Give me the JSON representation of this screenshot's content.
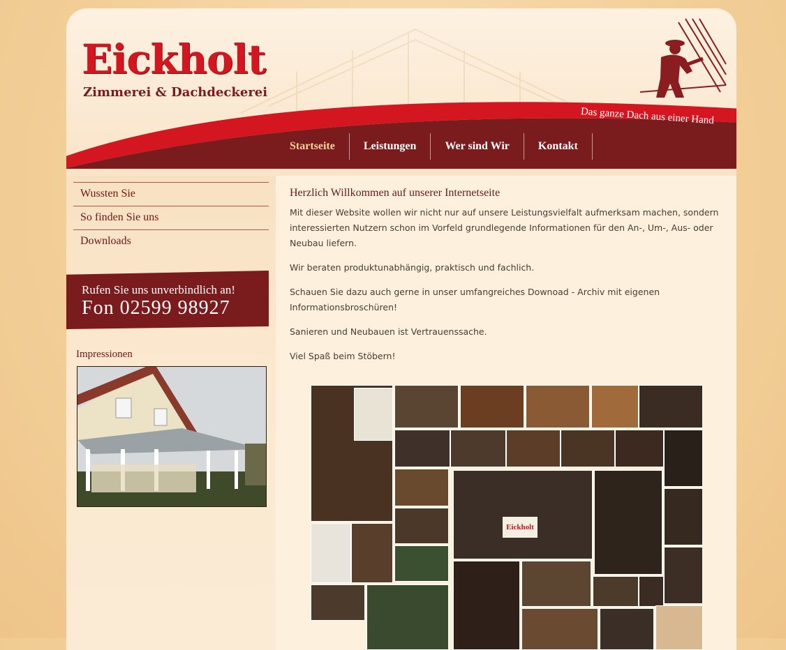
{
  "brand": {
    "name": "Eickholt",
    "subtitle": "Zimmerei & Dachdeckerei",
    "tagline": "Das ganze Dach aus einer Hand",
    "primary_color": "#d3161f",
    "dark_color": "#7a1b1d"
  },
  "nav": {
    "items": [
      {
        "label": "Startseite",
        "active": true
      },
      {
        "label": "Leistungen",
        "active": false
      },
      {
        "label": "Wer sind Wir",
        "active": false
      },
      {
        "label": "Kontakt",
        "active": false
      }
    ]
  },
  "sidebar": {
    "items": [
      {
        "label": "Wussten Sie"
      },
      {
        "label": "So finden Sie uns"
      },
      {
        "label": "Downloads"
      }
    ],
    "phone": {
      "label": "Rufen Sie uns unverbindlich an!",
      "number": "Fon 02599 98927"
    },
    "impressions_title": "Impressionen"
  },
  "main": {
    "heading": "Herzlich Willkommen auf unserer Internetseite",
    "paragraphs": [
      "Mit dieser Website wollen wir nicht nur auf unsere Leistungsvielfalt aufmerksam machen, sondern interessierten Nutzern schon im Vorfeld grundlegende Informationen für den An-, Um-, Aus- oder Neubau liefern.",
      "Wir beraten produktunabhängig, praktisch und fachlich.",
      "Schauen Sie dazu auch gerne in unser umfangreiches Downoad - Archiv mit eigenen Informationsbroschüren!",
      "Sanieren und Neubauen ist Vertrauenssache.",
      "Viel Spaß beim Stöbern!"
    ],
    "collage_banner": "Eickholt"
  }
}
